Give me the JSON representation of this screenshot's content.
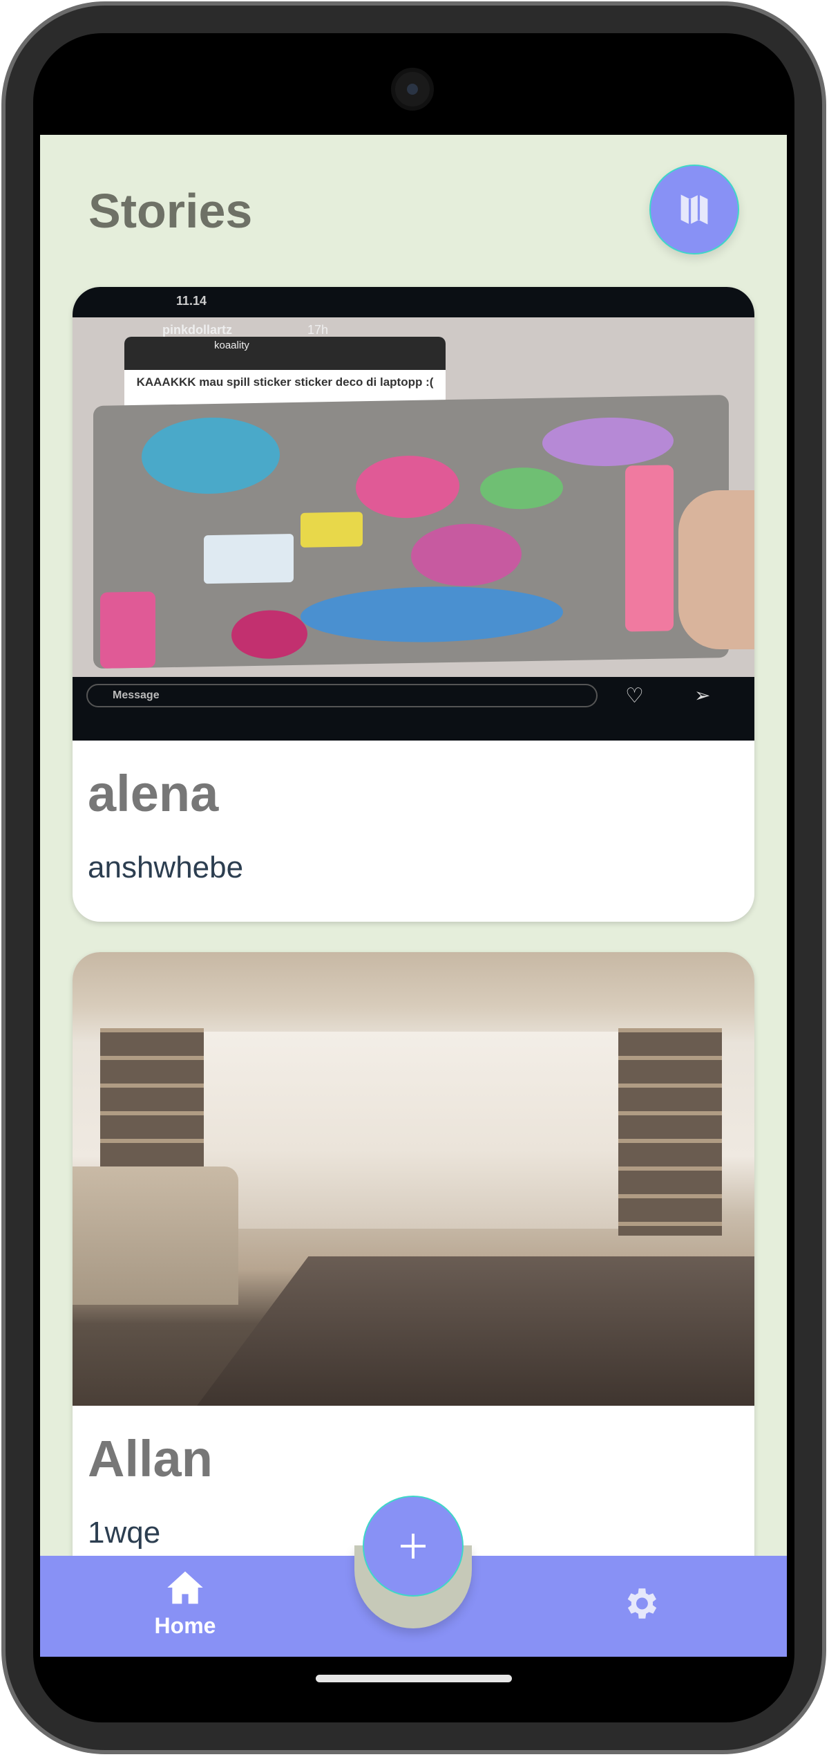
{
  "header": {
    "title": "Stories",
    "map_button_icon": "map-icon"
  },
  "stories": [
    {
      "name": "alena",
      "description": "anshwhebe",
      "image_text": {
        "time": "11.14",
        "user": "pinkdollartz",
        "age": "17h",
        "question_user": "koaality",
        "caption": "KAAAKKK mau spill sticker sticker deco di laptopp :(",
        "message_placeholder": "Message"
      }
    },
    {
      "name": "Allan",
      "description": "1wqe"
    }
  ],
  "bottom_nav": {
    "home_label": "Home",
    "add_icon": "plus-icon",
    "settings_icon": "gear-icon"
  },
  "colors": {
    "background": "#e5eedb",
    "accent": "#8891f5",
    "fab_border": "#3fd6c8",
    "title": "#6e7166"
  }
}
